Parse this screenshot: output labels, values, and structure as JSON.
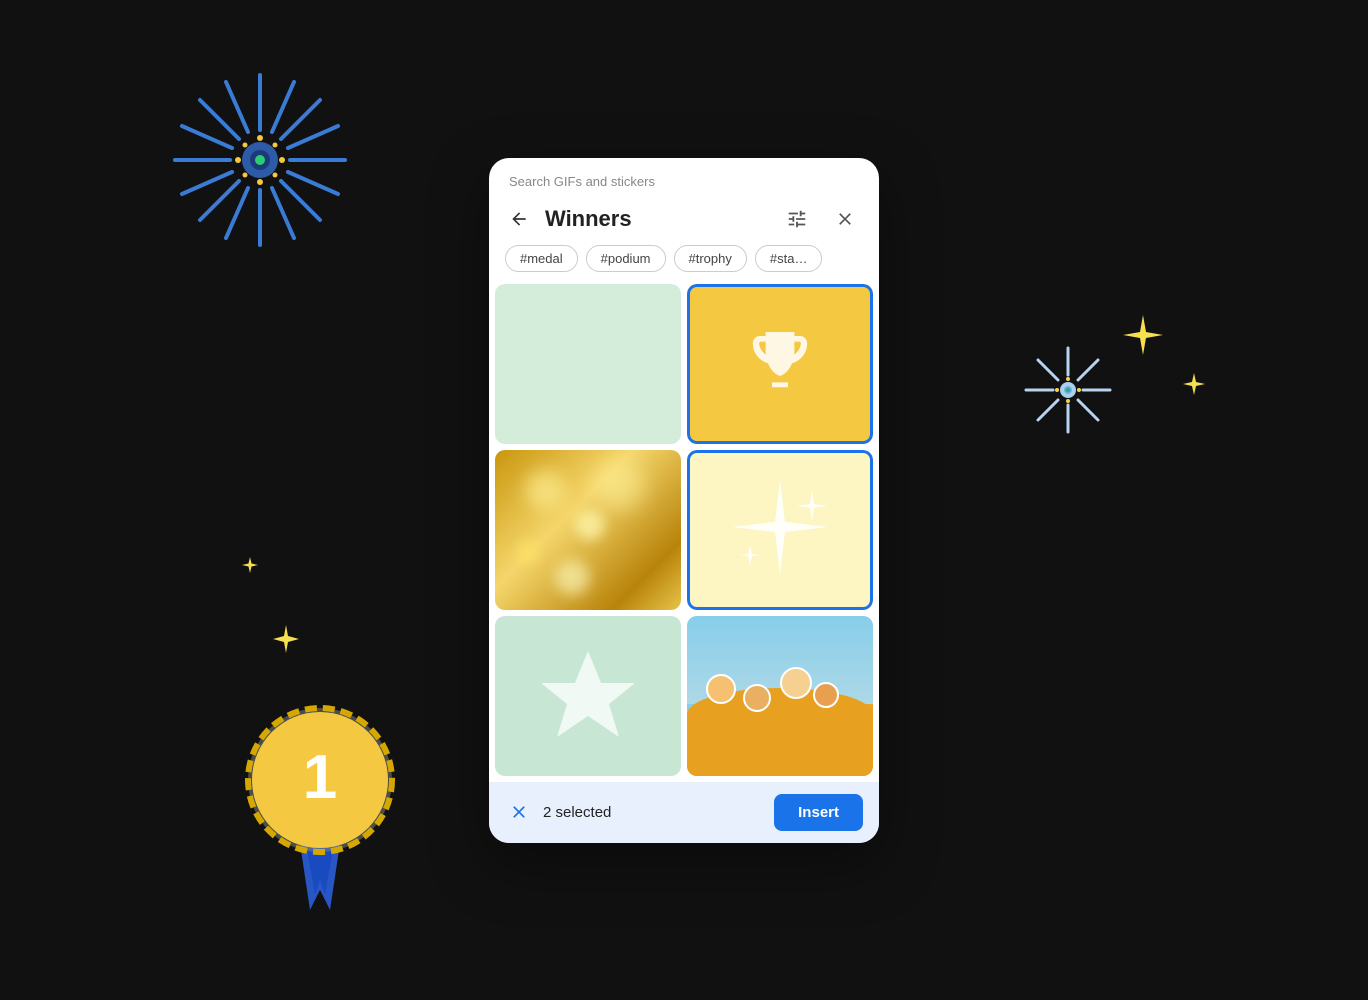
{
  "scene": {
    "background": "#111"
  },
  "dialog": {
    "search_hint": "Search GIFs and stickers",
    "title": "Winners",
    "back_label": "←",
    "close_label": "×",
    "tags": [
      "#medal",
      "#podium",
      "#trophy",
      "#sta…"
    ],
    "grid_items": [
      {
        "id": "item1",
        "type": "green",
        "selected": false,
        "label": "green placeholder"
      },
      {
        "id": "item2",
        "type": "trophy",
        "selected": true,
        "label": "trophy"
      },
      {
        "id": "item3",
        "type": "gold-bokeh",
        "selected": false,
        "label": "gold bokeh"
      },
      {
        "id": "item4",
        "type": "sparkles",
        "selected": true,
        "label": "sparkles"
      },
      {
        "id": "item5",
        "type": "star",
        "selected": false,
        "label": "star"
      },
      {
        "id": "item6",
        "type": "people",
        "selected": false,
        "label": "people"
      }
    ],
    "bottom_bar": {
      "selected_text": "2 selected",
      "clear_icon": "×",
      "insert_label": "Insert"
    }
  }
}
